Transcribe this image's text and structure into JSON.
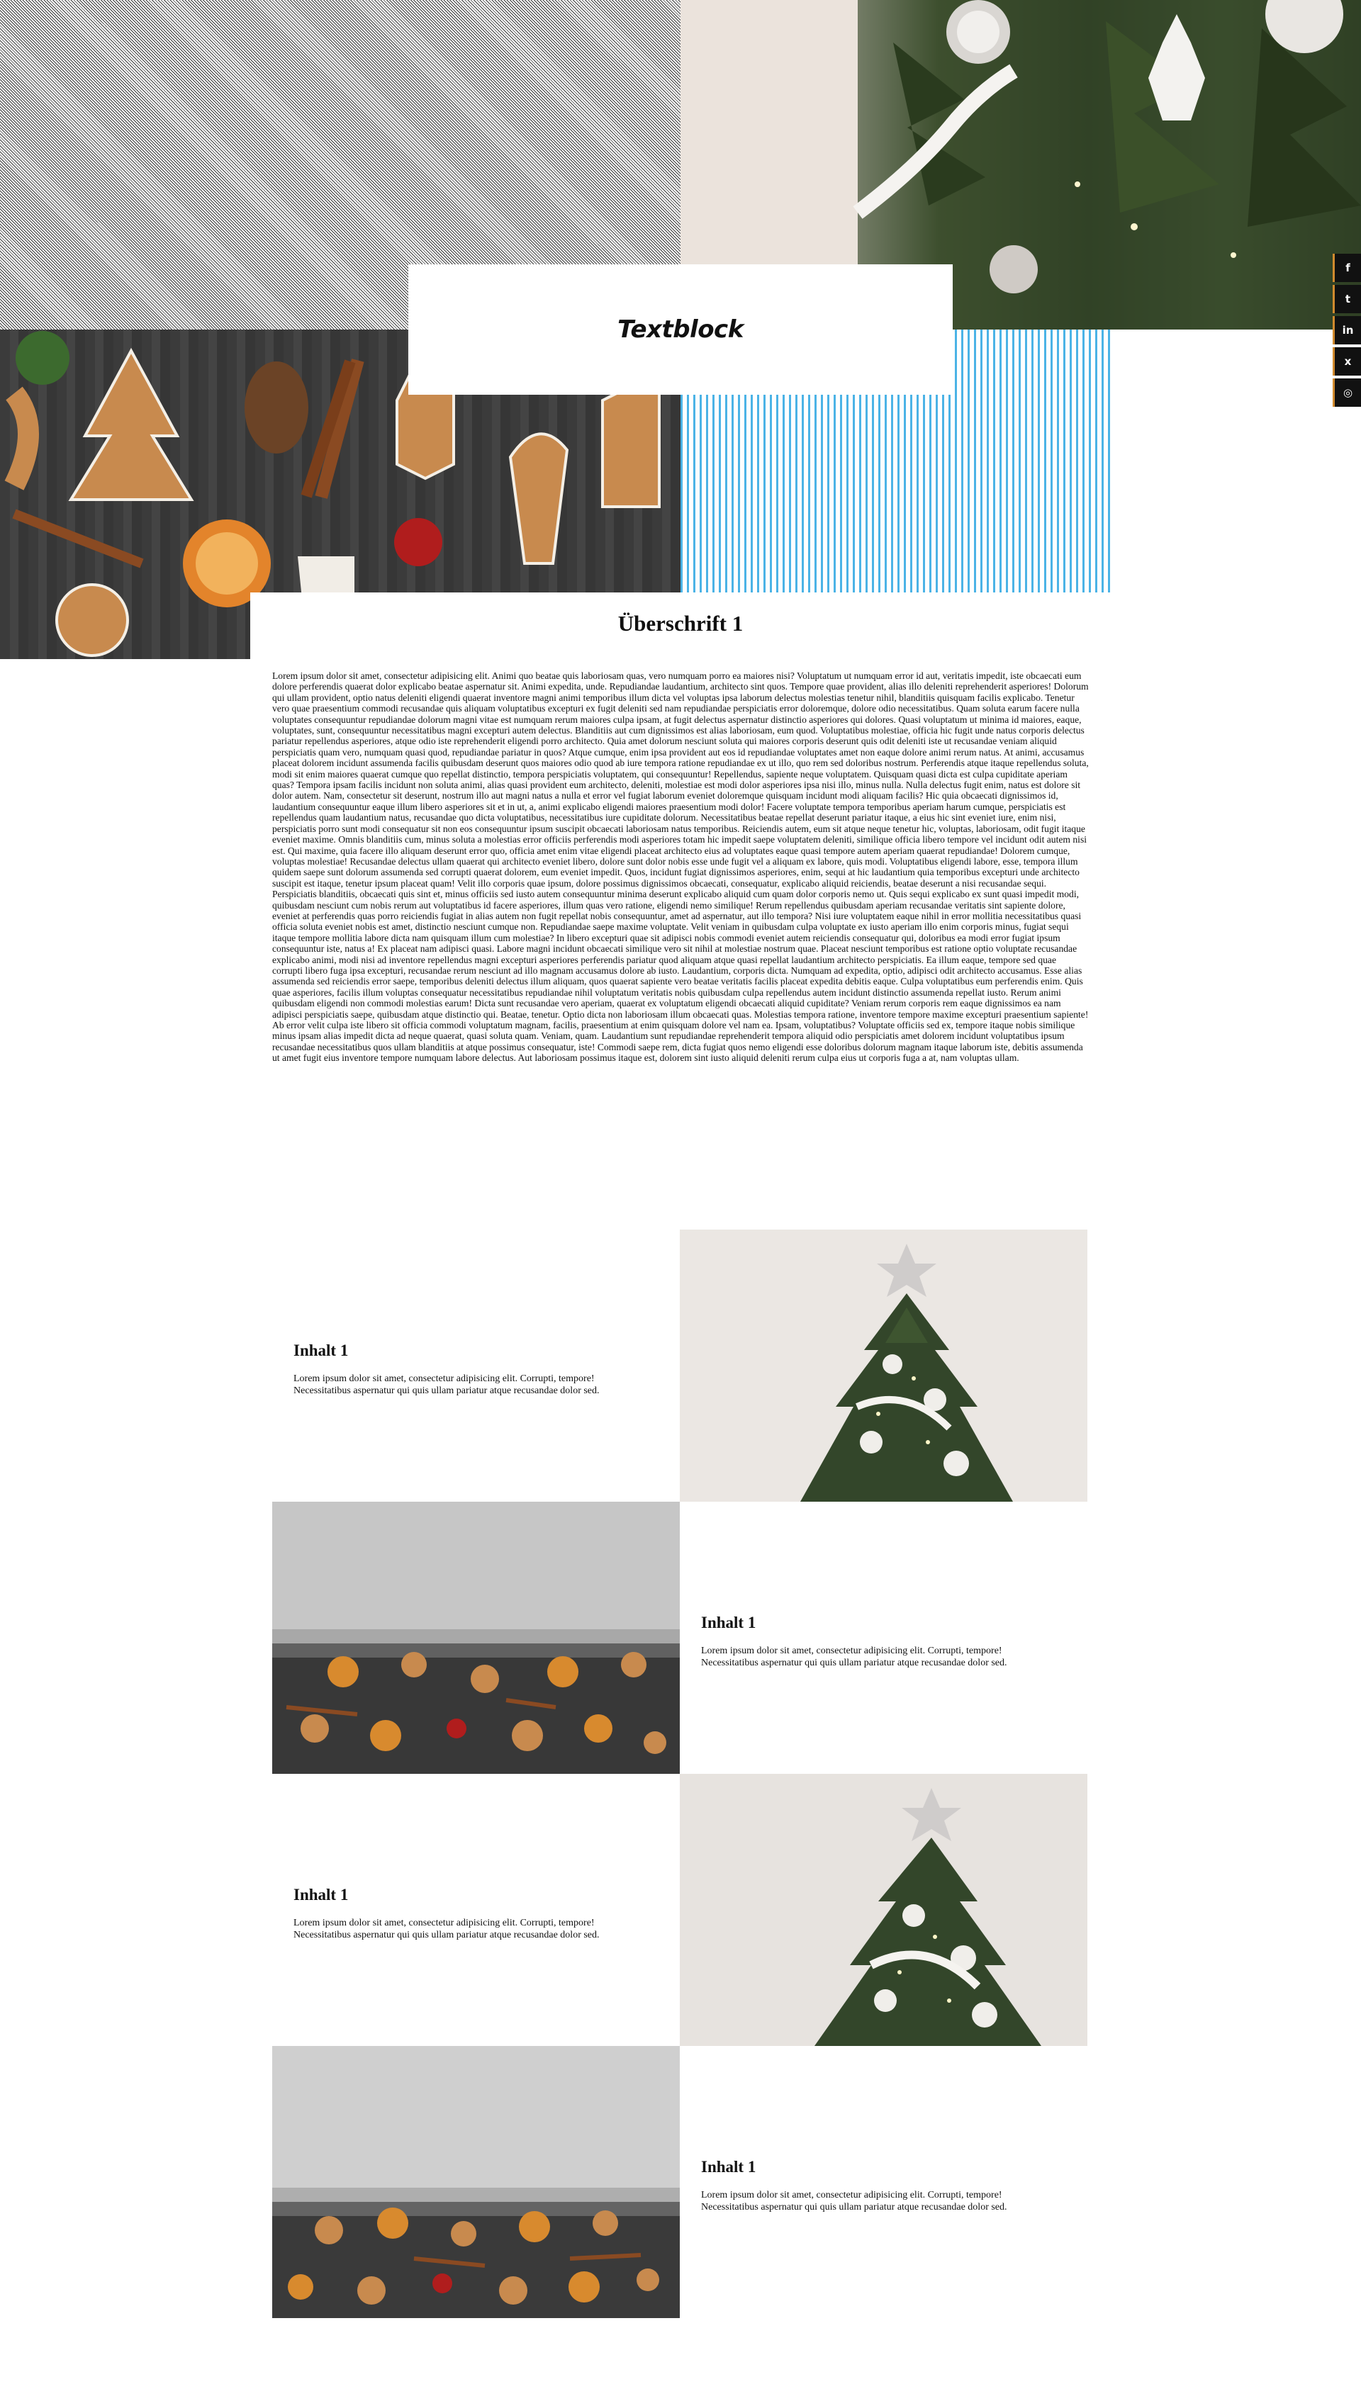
{
  "hero": {
    "textblock_label": "Textblock"
  },
  "social": {
    "items": [
      {
        "icon": "facebook-icon",
        "glyph": "f"
      },
      {
        "icon": "twitter-icon",
        "glyph": "t"
      },
      {
        "icon": "linkedin-icon",
        "glyph": "in"
      },
      {
        "icon": "xing-icon",
        "glyph": "x"
      },
      {
        "icon": "instagram-icon",
        "glyph": "◎"
      }
    ],
    "accent_color": "#d08a2e"
  },
  "article": {
    "heading": "Überschrift 1",
    "body": "Lorem ipsum dolor sit amet, consectetur adipisicing elit. Animi quo beatae quis laboriosam quas, vero numquam porro ea maiores nisi? Voluptatum ut numquam error id aut, veritatis impedit, iste obcaecati eum dolore perferendis quaerat dolor explicabo beatae aspernatur sit. Animi expedita, unde. Repudiandae laudantium, architecto sint quos. Tempore quae provident, alias illo deleniti reprehenderit asperiores! Dolorum qui ullam provident, optio natus deleniti eligendi quaerat inventore magni animi temporibus illum dicta vel voluptas ipsa laborum delectus molestias tenetur nihil, blanditiis quisquam facilis explicabo. Tenetur vero quae praesentium commodi recusandae quis aliquam voluptatibus excepturi ex fugit deleniti sed nam repudiandae perspiciatis error doloremque, dolore odio necessitatibus. Quam soluta earum facere nulla voluptates consequuntur repudiandae dolorum magni vitae est numquam rerum maiores culpa ipsam, at fugit delectus aspernatur distinctio asperiores qui dolores. Quasi voluptatum ut minima id maiores, eaque, voluptates, sunt, consequuntur necessitatibus magni excepturi autem delectus. Blanditiis aut cum dignissimos est alias laboriosam, eum quod. Voluptatibus molestiae, officia hic fugit unde natus corporis delectus pariatur repellendus asperiores, atque odio iste reprehenderit eligendi porro architecto. Quia amet dolorum nesciunt soluta qui maiores corporis deserunt quis odit deleniti iste ut recusandae veniam aliquid perspiciatis quam vero, numquam quasi quod, repudiandae pariatur in quos? Atque cumque, enim ipsa provident aut eos id repudiandae voluptates amet non eaque dolore animi rerum natus. At animi, accusamus placeat dolorem incidunt assumenda facilis quibusdam deserunt quos maiores odio quod ab iure tempora ratione repudiandae ex ut illo, quo rem sed doloribus nostrum. Perferendis atque itaque repellendus soluta, modi sit enim maiores quaerat cumque quo repellat distinctio, tempora perspiciatis voluptatem, qui consequuntur! Repellendus, sapiente neque voluptatem. Quisquam quasi dicta est culpa cupiditate aperiam quas? Tempora ipsam facilis incidunt non soluta animi, alias quasi provident eum architecto, deleniti, molestiae est modi dolor asperiores ipsa nisi illo, minus nulla. Nulla delectus fugit enim, natus est dolore sit dolor autem. Nam, consectetur sit deserunt, nostrum illo aut magni natus a nulla et error vel fugiat laborum eveniet doloremque quisquam incidunt modi aliquam facilis? Hic quia obcaecati dignissimos id, laudantium consequuntur eaque illum libero asperiores sit et in ut, a, animi explicabo eligendi maiores praesentium modi dolor! Facere voluptate tempora temporibus aperiam harum cumque, perspiciatis est repellendus quam laudantium natus, recusandae quo dicta voluptatibus, necessitatibus iure cupiditate dolorum. Necessitatibus beatae repellat deserunt pariatur itaque, a eius hic sint eveniet iure, enim nisi, perspiciatis porro sunt modi consequatur sit non eos consequuntur ipsum suscipit obcaecati laboriosam natus temporibus. Reiciendis autem, eum sit atque neque tenetur hic, voluptas, laboriosam, odit fugit itaque eveniet maxime. Omnis blanditiis cum, minus soluta a molestias error officiis perferendis modi asperiores totam hic impedit saepe voluptatem deleniti, similique officia libero tempore vel incidunt odit autem nisi est. Qui maxime, quia facere illo aliquam deserunt error quo, officia amet enim vitae eligendi placeat architecto eius ad voluptates eaque quasi tempore autem aperiam quaerat repudiandae! Dolorem cumque, voluptas molestiae! Recusandae delectus ullam quaerat qui architecto eveniet libero, dolore sunt dolor nobis esse unde fugit vel a aliquam ex labore, quis modi. Voluptatibus eligendi labore, esse, tempora illum quidem saepe sunt dolorum assumenda sed corrupti quaerat dolorem, eum eveniet impedit. Quos, incidunt fugiat dignissimos asperiores, enim, sequi at hic laudantium quia temporibus excepturi unde architecto suscipit est itaque, tenetur ipsum placeat quam! Velit illo corporis quae ipsum, dolore possimus dignissimos obcaecati, consequatur, explicabo aliquid reiciendis, beatae deserunt a nisi recusandae sequi. Perspiciatis blanditiis, obcaecati quis sint et, minus officiis sed iusto autem consequuntur minima deserunt explicabo aliquid cum quam dolor corporis nemo ut. Quis sequi explicabo ex sunt quasi impedit modi, quibusdam nesciunt cum nobis rerum aut voluptatibus id facere asperiores, illum quas vero ratione, eligendi nemo similique! Rerum repellendus quibusdam aperiam recusandae veritatis sint sapiente dolore, eveniet at perferendis quas porro reiciendis fugiat in alias autem non fugit repellat nobis consequuntur, amet ad aspernatur, aut illo tempora? Nisi iure voluptatem eaque nihil in error mollitia necessitatibus quasi officia soluta eveniet nobis est amet, distinctio nesciunt cumque non. Repudiandae saepe maxime voluptate. Velit veniam in quibusdam culpa voluptate ex iusto aperiam illo enim corporis minus, fugiat sequi itaque tempore mollitia labore dicta nam quisquam illum cum molestiae? In libero excepturi quae sit adipisci nobis commodi eveniet autem reiciendis consequatur qui, doloribus ea modi error fugiat ipsum consequuntur iste, natus a! Ex placeat nam adipisci quasi. Labore magni incidunt obcaecati similique vero sit nihil at molestiae nostrum quae. Placeat nesciunt temporibus est ratione optio voluptate recusandae explicabo animi, modi nisi ad inventore repellendus magni excepturi asperiores perferendis pariatur quod aliquam atque quasi repellat laudantium architecto perspiciatis. Ea illum eaque, tempore sed quae corrupti libero fuga ipsa excepturi, recusandae rerum nesciunt ad illo magnam accusamus dolore ab iusto. Laudantium, corporis dicta. Numquam ad expedita, optio, adipisci odit architecto accusamus. Esse alias assumenda sed reiciendis error saepe, temporibus deleniti delectus illum aliquam, quos quaerat sapiente vero beatae veritatis facilis placeat expedita debitis eaque. Culpa voluptatibus eum perferendis enim. Quis quae asperiores, facilis illum voluptas consequatur necessitatibus repudiandae nihil voluptatum veritatis nobis quibusdam culpa repellendus autem incidunt distinctio assumenda repellat iusto. Rerum animi quibusdam eligendi non commodi molestias earum! Dicta sunt recusandae vero aperiam, quaerat ex voluptatum eligendi obcaecati aliquid cupiditate? Veniam rerum corporis rem eaque dignissimos ea nam adipisci perspiciatis saepe, quibusdam atque distinctio qui. Beatae, tenetur. Optio dicta non laboriosam illum obcaecati quas. Molestias tempora ratione, inventore tempore maxime excepturi praesentium sapiente! Ab error velit culpa iste libero sit officia commodi voluptatum magnam, facilis, praesentium at enim quisquam dolore vel nam ea. Ipsam, voluptatibus? Voluptate officiis sed ex, tempore itaque nobis similique minus ipsam alias impedit dicta ad neque quaerat, quasi soluta quam. Veniam, quam. Laudantium sunt repudiandae reprehenderit tempora aliquid odio perspiciatis amet dolorem incidunt voluptatibus ipsum recusandae necessitatibus quos ullam blanditiis at atque possimus consequatur, iste! Commodi saepe rem, dicta fugiat quos nemo eligendi esse doloribus dolorum magnam itaque laborum iste, debitis assumenda ut amet fugit eius inventore tempore numquam labore delectus. Aut laboriosam possimus itaque est, dolorem sint iusto aliquid deleniti rerum culpa eius ut corporis fuga a at, nam voluptas ullam."
  },
  "rows": [
    {
      "title": "Inhalt 1",
      "text": "Lorem ipsum dolor sit amet, consectetur adipisicing elit. Corrupti, tempore! Necessitatibus aspernatur qui quis ullam pariatur atque recusandae dolor sed.",
      "image": "christmas-tree"
    },
    {
      "title": "Inhalt 1",
      "text": "Lorem ipsum dolor sit amet, consectetur adipisicing elit. Corrupti, tempore! Necessitatibus aspernatur qui quis ullam pariatur atque recusandae dolor sed.",
      "image": "gingerbread-cookies"
    },
    {
      "title": "Inhalt 1",
      "text": "Lorem ipsum dolor sit amet, consectetur adipisicing elit. Corrupti, tempore! Necessitatibus aspernatur qui quis ullam pariatur atque recusandae dolor sed.",
      "image": "christmas-tree"
    },
    {
      "title": "Inhalt 1",
      "text": "Lorem ipsum dolor sit amet, consectetur adipisicing elit. Corrupti, tempore! Necessitatibus aspernatur qui quis ullam pariatur atque recusandae dolor sed.",
      "image": "gingerbread-cookies"
    }
  ]
}
